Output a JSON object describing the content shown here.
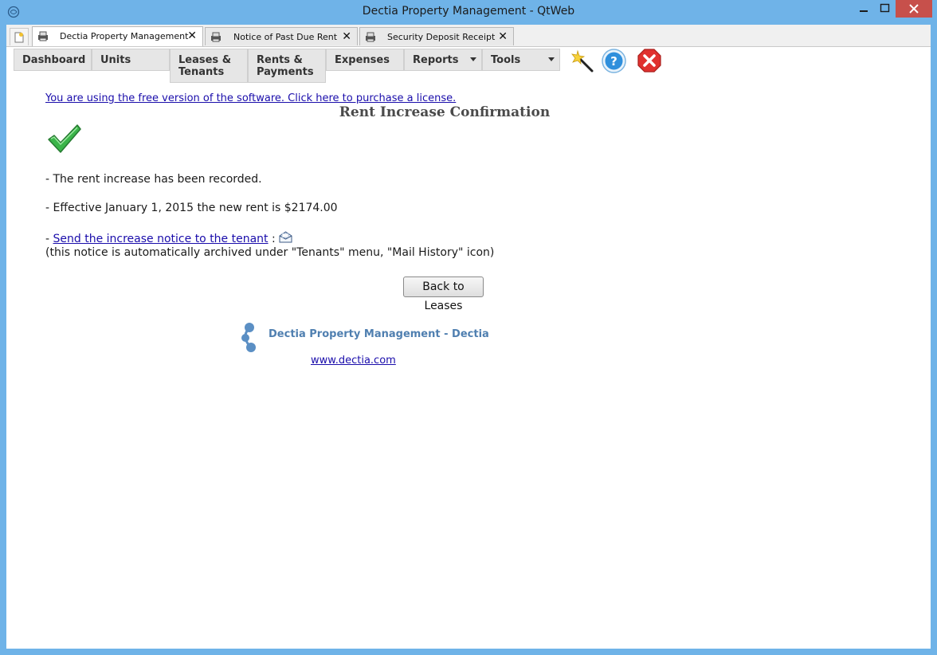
{
  "window": {
    "title": "Dectia Property Management - QtWeb",
    "minimize_glyph": "—",
    "maximize_glyph": "□",
    "close_glyph": "✕"
  },
  "tabs": [
    {
      "label": "Dectia Property Management",
      "active": true
    },
    {
      "label": "Notice of Past Due Rent",
      "active": false
    },
    {
      "label": "Security Deposit Receipt",
      "active": false
    }
  ],
  "tab_close_glyph": "✕",
  "menu": {
    "dashboard": "Dashboard",
    "units": "Units",
    "leases_line1": "Leases &",
    "leases_line2": "Tenants",
    "rents_line1": "Rents &",
    "rents_line2": "Payments",
    "expenses": "Expenses",
    "reports": "Reports",
    "tools": "Tools"
  },
  "icons": {
    "app": "qtweb-globe-icon",
    "new_tab": "new-page-icon",
    "tab": "printer-icon",
    "wizard": "magic-wand-icon",
    "help": "help-icon",
    "exit": "exit-icon",
    "success": "checkmark-icon",
    "mail": "envelope-icon",
    "logo": "dectia-logo-icon"
  },
  "colors": {
    "titlebar": "#6fb3e8",
    "close_button": "#c7504b",
    "link": "#1a0dab",
    "brand": "#4f7fb0",
    "check_green": "#3bb54a",
    "help_blue": "#2f8fdc",
    "exit_red": "#e0312f"
  },
  "content": {
    "license_notice": "You are using the free version of the software. Click here to purchase a license.",
    "heading": "Rent Increase Confirmation",
    "line1": "- The rent increase has been recorded.",
    "line2": "- Effective January 1, 2015 the new rent is $2174.00",
    "line3_prefix": "- ",
    "notice_link": "Send the increase notice to the tenant",
    "line3_suffix": " : ",
    "archive_note": "(this notice is automatically archived under \"Tenants\" menu, \"Mail History\" icon)",
    "back_button": "Back to Leases"
  },
  "footer": {
    "brand": "Dectia Property Management - Dectia",
    "website": "www.dectia.com"
  }
}
